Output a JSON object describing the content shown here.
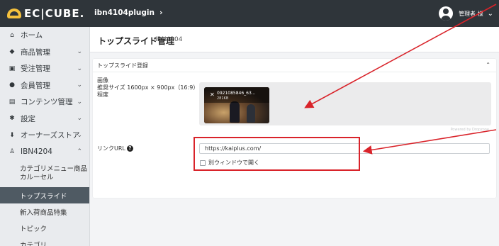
{
  "header": {
    "logo_text": "EC|CUBE.",
    "shop_name": "ibn4104plugin",
    "shop_chevron": "›",
    "user_label": "管理者 様",
    "user_chevron": "⌄"
  },
  "sidebar": {
    "items": [
      {
        "icon": "home-icon",
        "glyph": "⌂",
        "label": "ホーム",
        "chevron": ""
      },
      {
        "icon": "tag-icon",
        "glyph": "◆",
        "label": "商品管理",
        "chevron": "⌄"
      },
      {
        "icon": "cart-icon",
        "glyph": "▣",
        "label": "受注管理",
        "chevron": "⌄"
      },
      {
        "icon": "users-icon",
        "glyph": "●",
        "label": "会員管理",
        "chevron": "⌄"
      },
      {
        "icon": "file-icon",
        "glyph": "▤",
        "label": "コンテンツ管理",
        "chevron": "⌄"
      },
      {
        "icon": "gear-icon",
        "glyph": "✱",
        "label": "設定",
        "chevron": "⌄"
      },
      {
        "icon": "plug-icon",
        "glyph": "⬇",
        "label": "オーナーズストア",
        "chevron": "⌄"
      },
      {
        "icon": "user-plugin-icon",
        "glyph": "♙",
        "label": "IBN4204",
        "chevron": "⌃"
      }
    ],
    "sub_items": [
      {
        "label": "カテゴリメニュー商品カルーセル"
      },
      {
        "label": "トップスライド"
      },
      {
        "label": "新入荷商品特集"
      },
      {
        "label": "トピック"
      },
      {
        "label": "カテゴリ"
      }
    ]
  },
  "main": {
    "page_title": "トップスライド管理",
    "page_subtitle": "IBN4204",
    "card_title": "トップスライド登録",
    "collapse_glyph": "⌃",
    "image_label": "画像",
    "image_hint": "推奨サイズ 1600px × 900px（16:9）程度",
    "thumbnail_name": "0921085846_63...",
    "thumbnail_size": "281KB",
    "powered_by": "Powered by Dropzone",
    "link_label": "リンクURL",
    "link_help_glyph": "?",
    "link_value": "https://kaiplus.com/",
    "new_window_label": "別ウィンドウで開く"
  },
  "colors": {
    "topbar": "#2f353a",
    "logo_accent": "#f5c13d",
    "annotation": "#d9232a",
    "active_nav": "#4f5a63"
  }
}
